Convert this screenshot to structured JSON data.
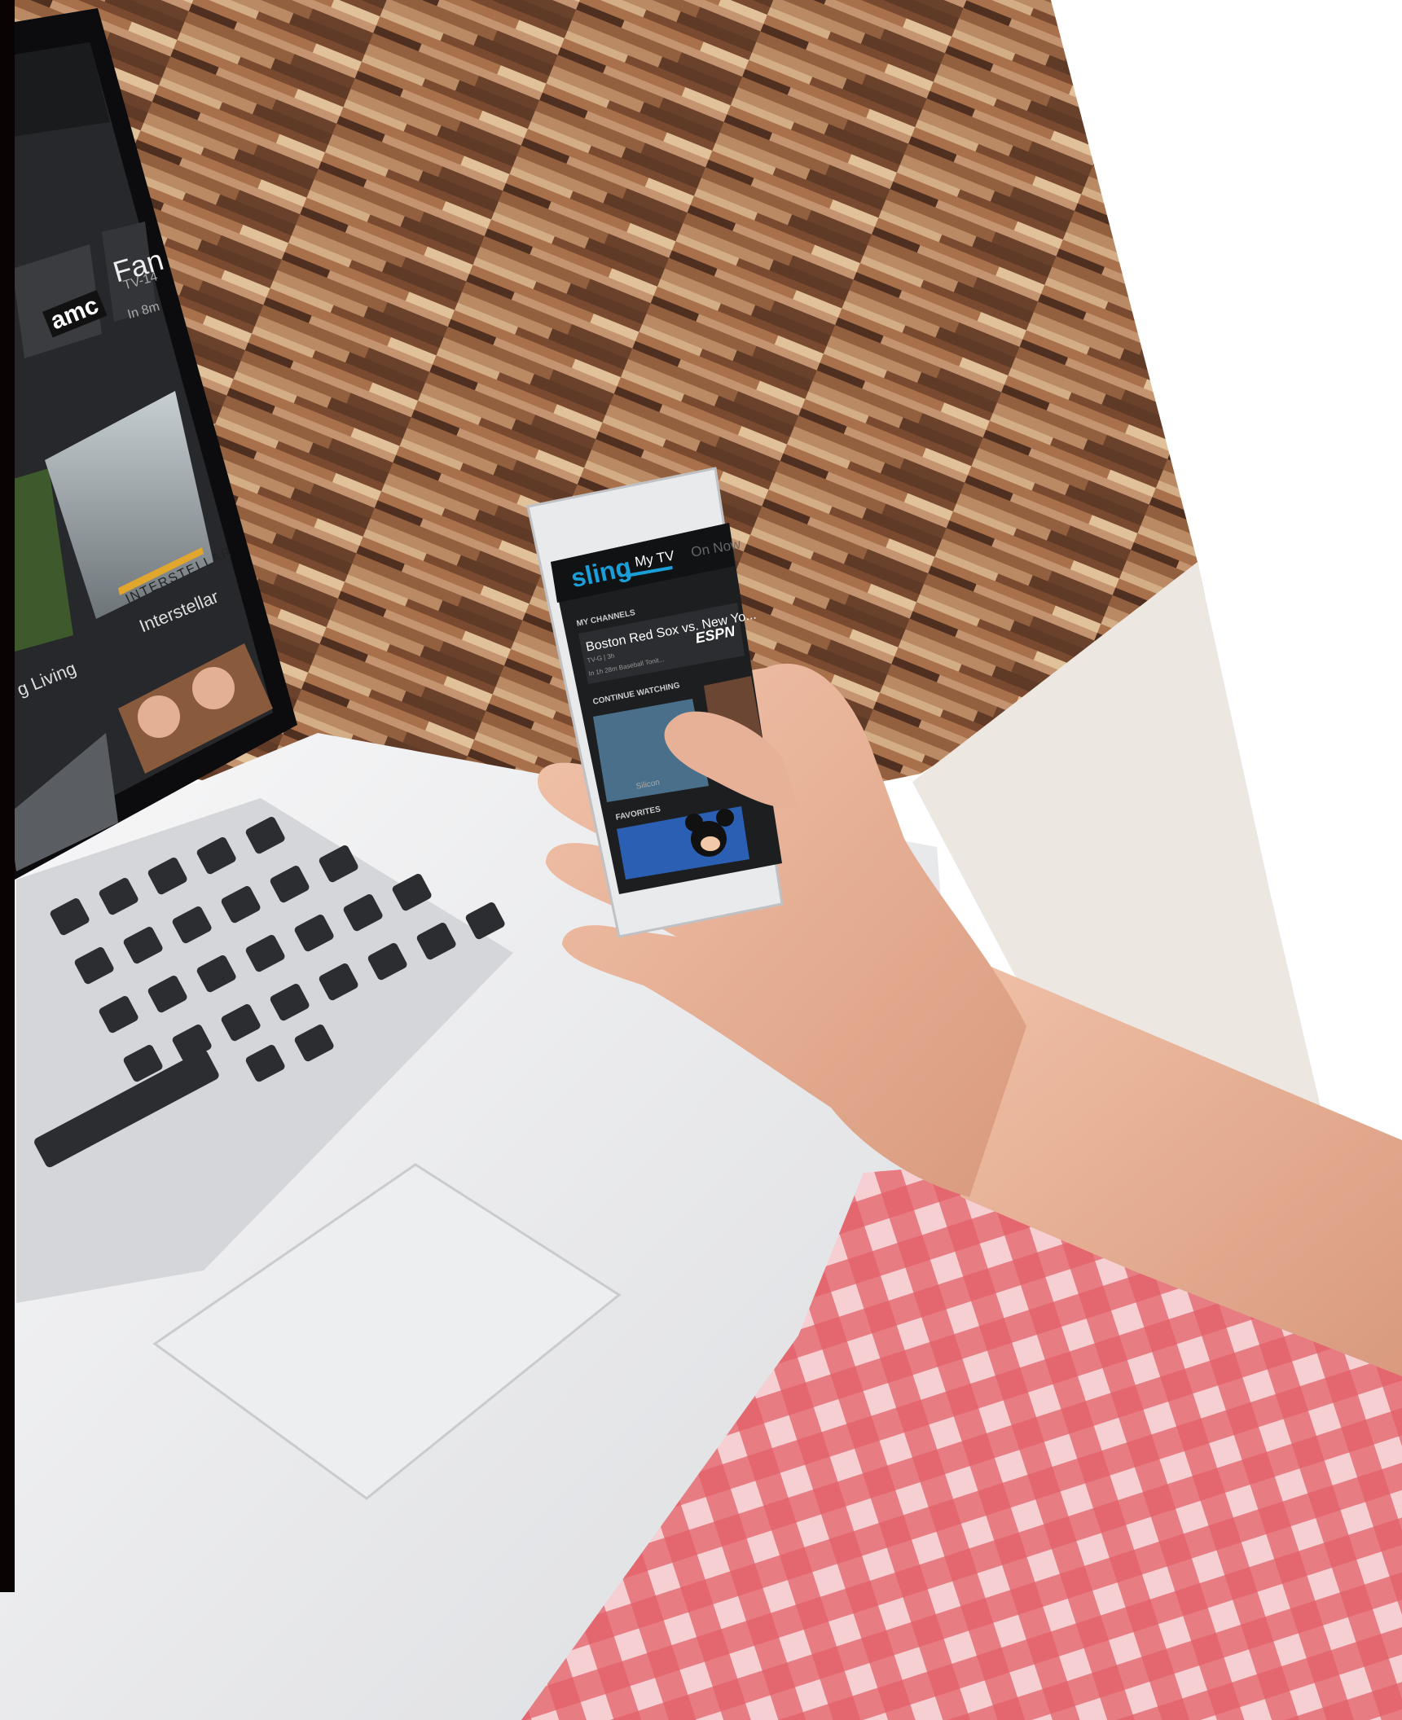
{
  "laptop_screen": {
    "channel_logo": "amc",
    "featured_title": "Fan",
    "featured_rating": "TV-14",
    "featured_time": "In 8m",
    "poster_1_title": "Interstellar",
    "poster_1_art_text": "INTERSTELLAR",
    "poster_2_title": "g Living"
  },
  "phone_app": {
    "logo": "sling",
    "tabs": [
      "My TV",
      "On Now"
    ],
    "active_tab": "My TV",
    "sections": {
      "my_channels": {
        "heading": "MY CHANNELS",
        "title": "Boston Red Sox vs. New Yo...",
        "meta": "TV-G | 3h",
        "status": "In 1h 28m  Baseball Tonit...",
        "network": "ESPN"
      },
      "continue_watching": {
        "heading": "CONTINUE WATCHING",
        "item_label": "Silicon"
      },
      "favorites": {
        "heading": "FAVORITES"
      }
    },
    "accent_color": "#1a9fd8"
  },
  "colors": {
    "shirt_red": "#d9404b",
    "wood_brown": "#8a5234",
    "skin": "#e6b096"
  }
}
